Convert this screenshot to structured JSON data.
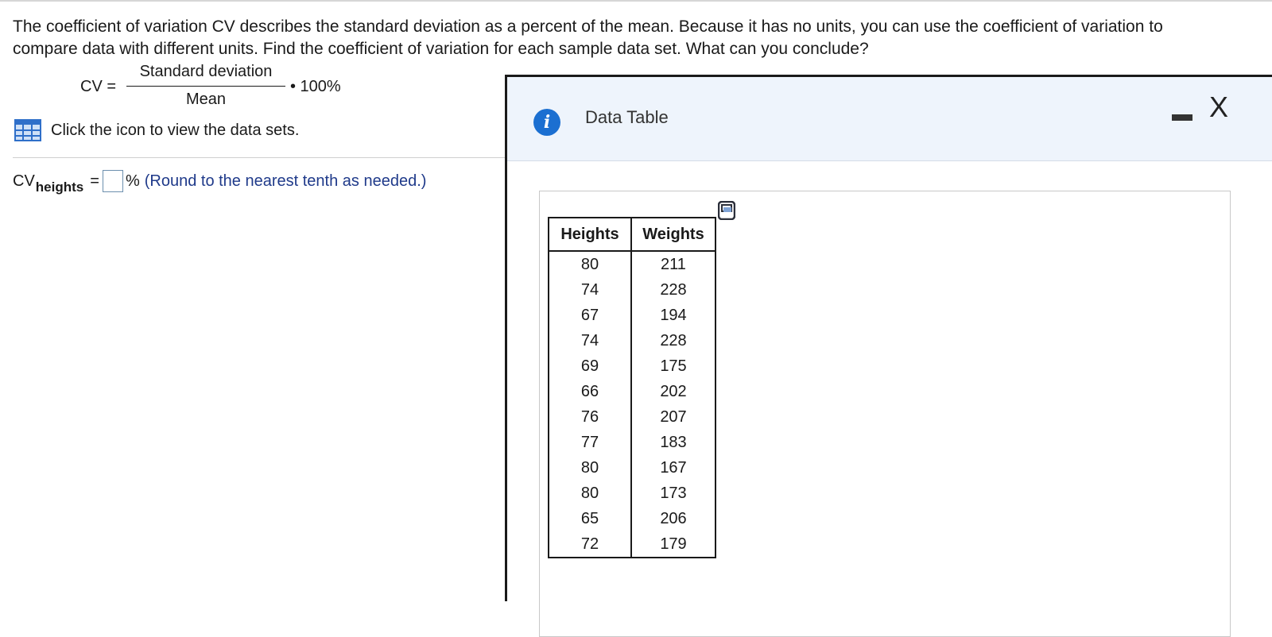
{
  "problem": {
    "text": "The coefficient of variation CV describes the standard deviation as a percent of the mean. Because it has no units, you can use the coefficient of variation to compare data with different units. Find the coefficient of variation for each sample data set. What can you conclude?",
    "formula_lhs": "CV =",
    "numerator": "Standard deviation",
    "denominator": "Mean",
    "multiplier": "• 100%"
  },
  "hint": {
    "icon": "table-grid-icon",
    "text": "Click the icon to view the data sets."
  },
  "answer": {
    "prefix": "CV",
    "subscript": "heights",
    "equals": "=",
    "value": "",
    "percent": "%",
    "note": "(Round to the nearest tenth as needed.)"
  },
  "dialog": {
    "title": "Data Table",
    "info_icon": "info-icon",
    "minimize_label": "",
    "close_label": "X"
  },
  "data_table": {
    "headers": [
      "Heights",
      "Weights"
    ],
    "rows": [
      [
        "80",
        "211"
      ],
      [
        "74",
        "228"
      ],
      [
        "67",
        "194"
      ],
      [
        "74",
        "228"
      ],
      [
        "69",
        "175"
      ],
      [
        "66",
        "202"
      ],
      [
        "76",
        "207"
      ],
      [
        "77",
        "183"
      ],
      [
        "80",
        "167"
      ],
      [
        "80",
        "173"
      ],
      [
        "65",
        "206"
      ],
      [
        "72",
        "179"
      ]
    ]
  },
  "colors": {
    "accent_blue": "#1b6fd1",
    "note_blue": "#1f3a8a",
    "dialog_header_bg": "#eef4fc"
  }
}
